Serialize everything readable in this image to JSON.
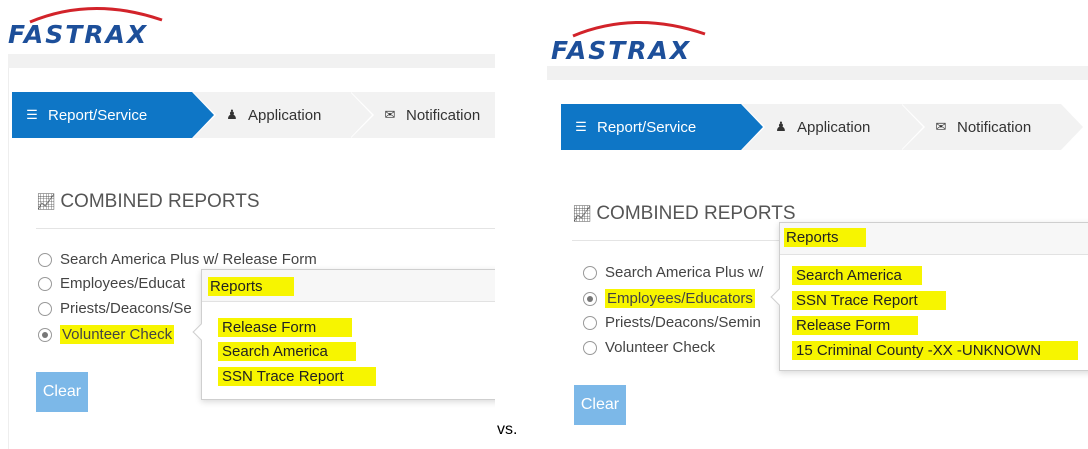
{
  "left": {
    "logo": "FASTRAX",
    "tabs": [
      {
        "label": "Report/Service",
        "icon": "list-icon"
      },
      {
        "label": "Application",
        "icon": "user-icon"
      },
      {
        "label": "Notification",
        "icon": "envelope-icon"
      }
    ],
    "section_title": "COMBINED REPORTS",
    "options": [
      {
        "label": "Search America Plus w/ Release Form",
        "checked": false
      },
      {
        "label": "Employees/Educat",
        "checked": false
      },
      {
        "label": "Priests/Deacons/Se",
        "checked": false
      },
      {
        "label": "Volunteer Check",
        "checked": true
      }
    ],
    "clear_label": "Clear",
    "popover": {
      "title": "Reports",
      "items": [
        "Release Form",
        "Search America",
        "SSN Trace Report"
      ]
    }
  },
  "separator": "vs.",
  "right": {
    "logo": "FASTRAX",
    "tabs": [
      {
        "label": "Report/Service",
        "icon": "list-icon"
      },
      {
        "label": "Application",
        "icon": "user-icon"
      },
      {
        "label": "Notification",
        "icon": "envelope-icon"
      }
    ],
    "section_title": "COMBINED REPORTS",
    "options": [
      {
        "label": "Search America Plus w/",
        "checked": false
      },
      {
        "label": "Employees/Educators",
        "checked": true
      },
      {
        "label": "Priests/Deacons/Semin",
        "checked": false
      },
      {
        "label": "Volunteer Check",
        "checked": false
      }
    ],
    "clear_label": "Clear",
    "popover": {
      "title": "Reports",
      "items": [
        "Search America",
        "SSN Trace Report",
        "Release Form",
        "15 Criminal County -XX -UNKNOWN"
      ]
    }
  },
  "colors": {
    "tab_active": "#0e76c6",
    "highlight": "#f7f500",
    "clear_button": "#7cb8e8",
    "logo": "#1d4f9a"
  }
}
